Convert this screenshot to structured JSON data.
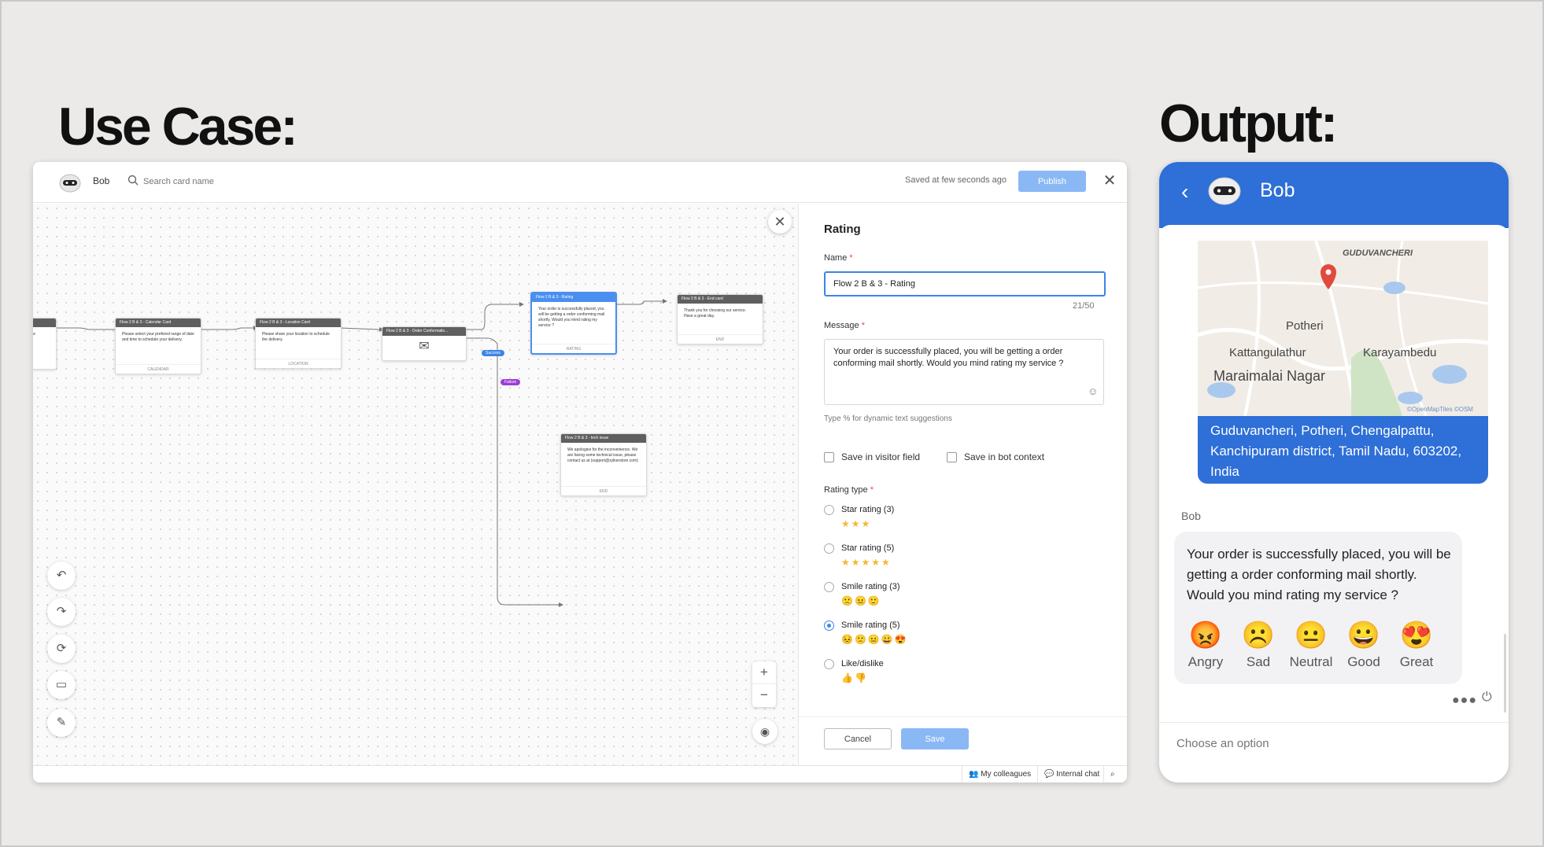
{
  "headings": {
    "left": "Use Case:",
    "right": "Output:"
  },
  "builder": {
    "bot_name": "Bob",
    "search_placeholder": "Search card name",
    "saved_text": "Saved at few seconds ago",
    "publish_label": "Publish",
    "cards": [
      {
        "title": "",
        "body": "phone",
        "foot": ""
      },
      {
        "title": "Flow 2 B & 3 - Calendar Card",
        "body": "Please select your prefered range of date and time to schedule your delivery.",
        "foot": "CALENDAR"
      },
      {
        "title": "Flow 2 B & 3 - Location Card",
        "body": "Please share your location to schedule the delivery.",
        "foot": "LOCATION"
      },
      {
        "title": "Flow 2 B & 3 - Order Conformatio...",
        "body": "",
        "foot": ""
      },
      {
        "title": "Flow 2 B & 3 - Rating",
        "body": "Your order is successfully placed, you will be getting a order conforming mail shortly. Would you mind rating my service ?",
        "foot": "RATING"
      },
      {
        "title": "Flow 2 B & 3 - End card",
        "body": "Thank you for choosing our service. Have a great day.",
        "foot": "END"
      },
      {
        "title": "Flow 2 B & 3 - tech issue",
        "body": "We apologies for the inconvenience. We are facing some technical issue, please contact us at (support@zylkerstore.com)",
        "foot": "END"
      }
    ],
    "tag_success": "Success",
    "tag_failure": "Failure",
    "tag_colors": {
      "success": "#3d84e6",
      "failure": "#9b3fd6"
    }
  },
  "panel": {
    "title": "Rating",
    "name_label": "Name",
    "name_value": "Flow 2 B & 3 - Rating",
    "name_count": "21/50",
    "message_label": "Message",
    "message_value": "Your order is successfully placed, you will be getting a order conforming mail shortly. Would you mind rating my service ?",
    "message_hint": "Type % for dynamic text suggestions",
    "save_visitor": "Save in visitor field",
    "save_bot": "Save in bot context",
    "rating_type_label": "Rating type",
    "options": [
      {
        "label": "Star rating (3)",
        "glyphs": "★★★",
        "selected": false
      },
      {
        "label": "Star rating (5)",
        "glyphs": "★★★★★",
        "selected": false
      },
      {
        "label": "Smile rating (3)",
        "glyphs": "🙁😐🙂",
        "selected": false
      },
      {
        "label": "Smile rating (5)",
        "glyphs": "😣🙁😐😀😍",
        "selected": true
      },
      {
        "label": "Like/dislike",
        "glyphs": "👍👎",
        "selected": false
      }
    ],
    "cancel_label": "Cancel",
    "save_label": "Save"
  },
  "statusbar": {
    "colleagues": "My colleagues",
    "internal_chat": "Internal chat"
  },
  "chat": {
    "bot_name": "Bob",
    "map_labels": [
      "GUDUVANCHERI",
      "Potheri",
      "Kattangulathur",
      "Karayambedu",
      "Maraimalai Nagar",
      "©OpenMapTiles ©OSM"
    ],
    "address": "Guduvancheri, Potheri, Chengalpattu, Kanchipuram district, Tamil Nadu, 603202, India",
    "sender": "Bob",
    "message": "Your order is successfully placed, you will be getting a order conforming mail shortly. Would you mind rating my service ?",
    "emojis": [
      {
        "face": "😡",
        "label": "Angry"
      },
      {
        "face": "☹️",
        "label": "Sad"
      },
      {
        "face": "😐",
        "label": "Neutral"
      },
      {
        "face": "😀",
        "label": "Good"
      },
      {
        "face": "😍",
        "label": "Great"
      }
    ],
    "input_placeholder": "Choose an option",
    "colors": {
      "header": "#2e6fd8",
      "accent": "#3d84e6"
    }
  }
}
